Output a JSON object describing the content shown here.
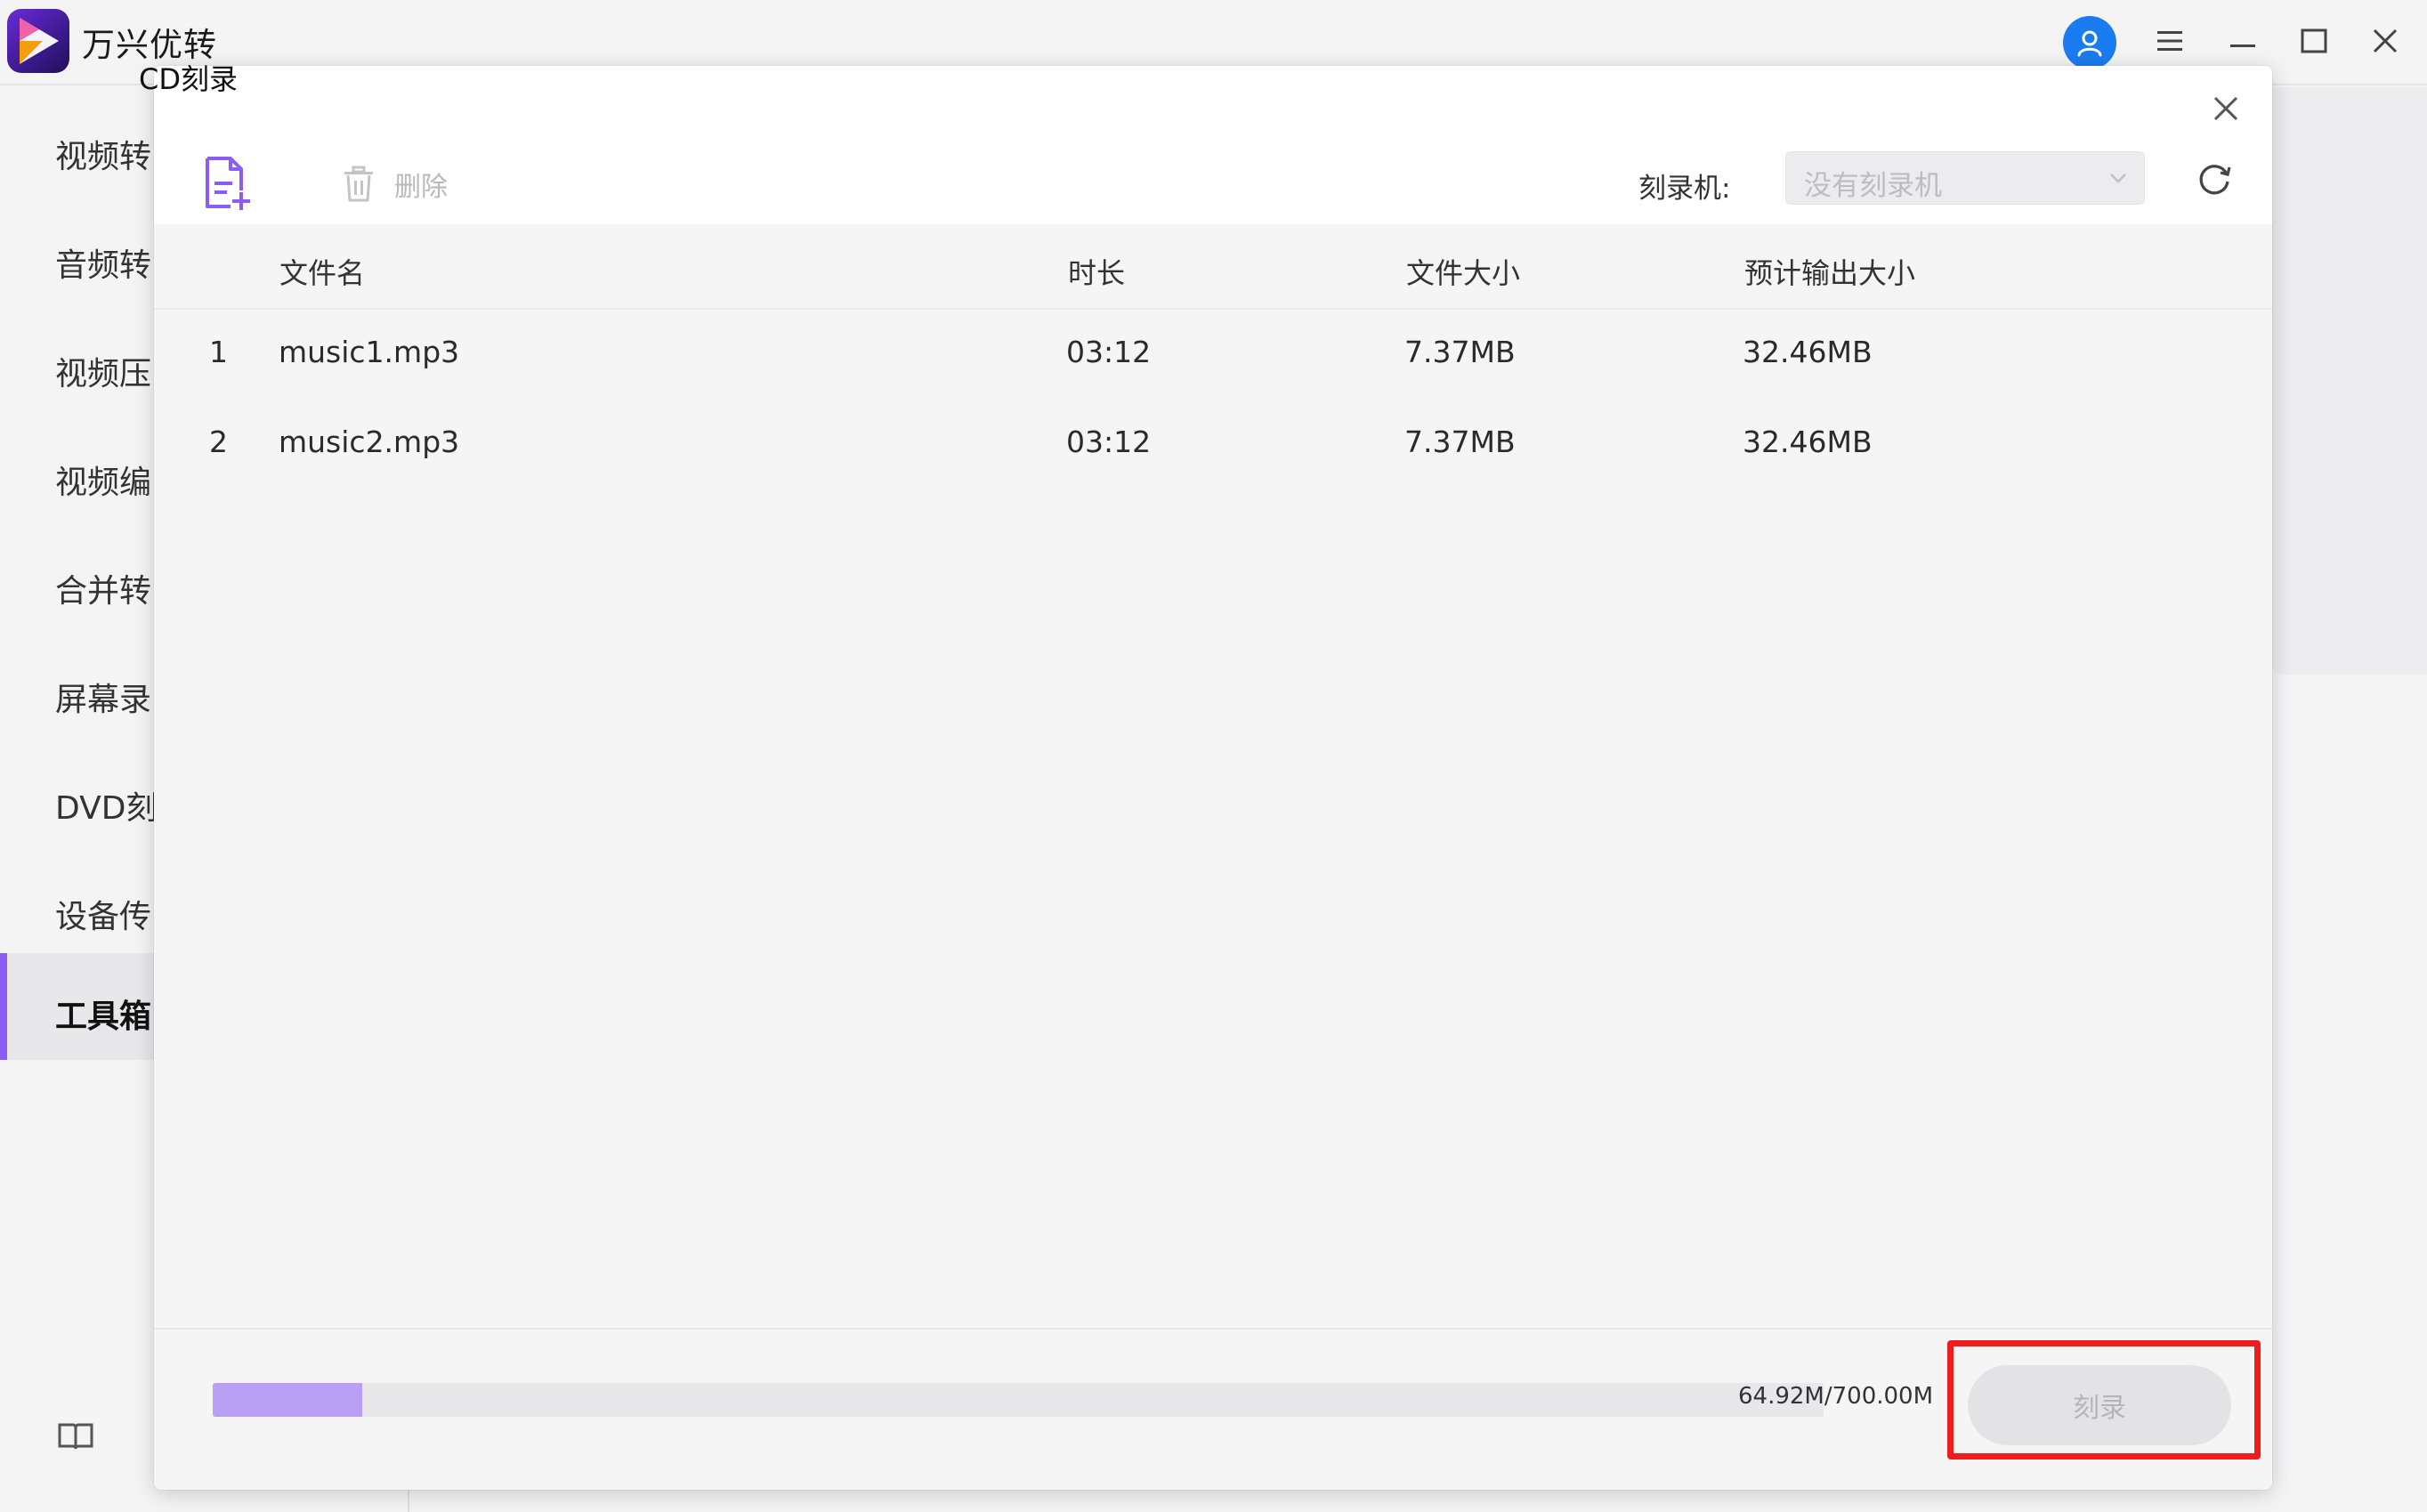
{
  "app": {
    "name": "万兴优转"
  },
  "sidebar": {
    "items": [
      {
        "label": "视频转"
      },
      {
        "label": "音频转"
      },
      {
        "label": "视频压"
      },
      {
        "label": "视频编"
      },
      {
        "label": "合并转"
      },
      {
        "label": "屏幕录"
      },
      {
        "label": "DVD刻"
      },
      {
        "label": "设备传"
      },
      {
        "label": "工具箱",
        "active": true
      }
    ]
  },
  "dialog": {
    "title": "CD刻录",
    "toolbar": {
      "add_file_icon": "add-file-icon",
      "delete_label": "删除",
      "burner_label": "刻录机:",
      "burner_select_value": "没有刻录机"
    },
    "table": {
      "columns": [
        "文件名",
        "时长",
        "文件大小",
        "预计输出大小"
      ],
      "rows": [
        {
          "index": "1",
          "name": "music1.mp3",
          "duration": "03:12",
          "size": "7.37MB",
          "output_size": "32.46MB"
        },
        {
          "index": "2",
          "name": "music2.mp3",
          "duration": "03:12",
          "size": "7.37MB",
          "output_size": "32.46MB"
        }
      ]
    },
    "footer": {
      "capacity_text": "64.92M/700.00M",
      "progress_fraction": 0.0927,
      "burn_label": "刻录"
    }
  },
  "colors": {
    "accent": "#8b5cf6",
    "progress_fill": "#b9a0f5",
    "avatar_blue": "#1a7cf0",
    "highlight": "#ee1c1c"
  }
}
